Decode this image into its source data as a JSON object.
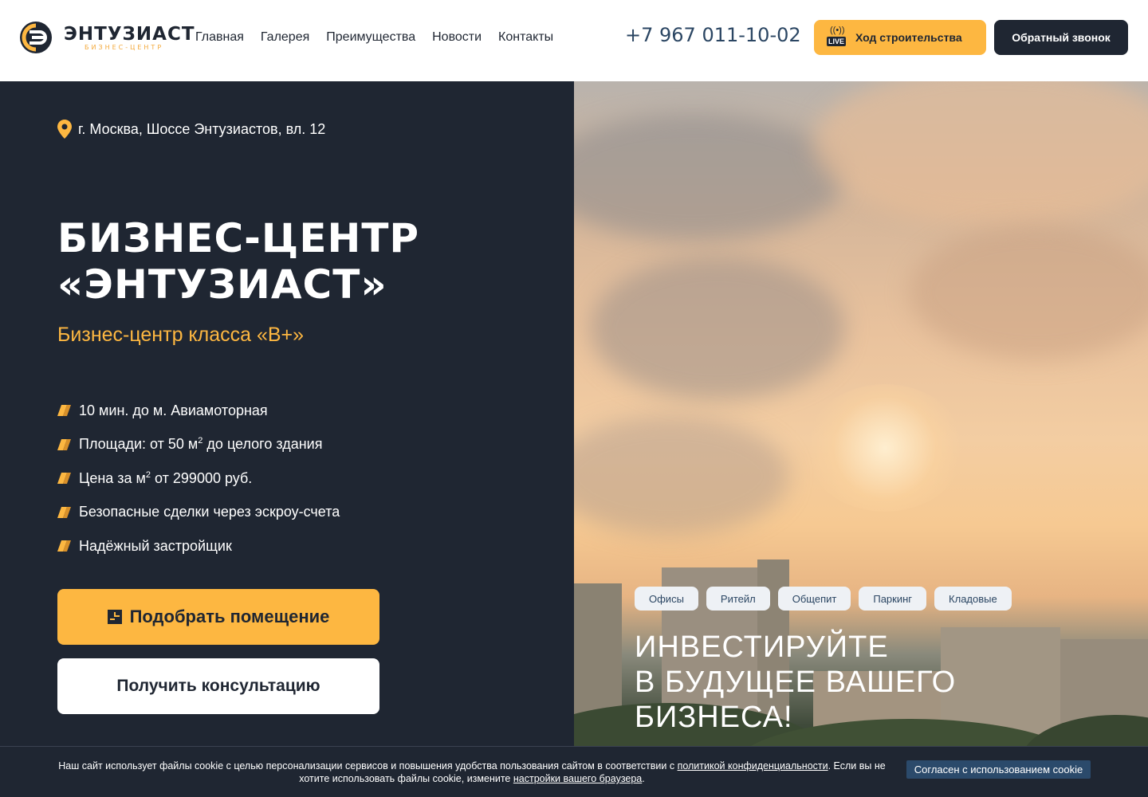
{
  "brand": {
    "name": "ЭНТУЗИАСТ",
    "subtitle": "БИЗНЕС-ЦЕНТР",
    "accent_color": "#fdb741",
    "dark_color": "#1f2632"
  },
  "nav": {
    "items": [
      {
        "label": "Главная"
      },
      {
        "label": "Галерея"
      },
      {
        "label": "Преимущества"
      },
      {
        "label": "Новости"
      },
      {
        "label": "Контакты"
      }
    ]
  },
  "header": {
    "phone": "+7 967 011-10-02",
    "live_badge": "LIVE",
    "live_button": "Ход строительства",
    "callback_button": "Обратный звонок"
  },
  "hero": {
    "address": "г. Москва, Шоссе Энтузиастов, вл. 12",
    "title_line1": "БИЗНЕС-ЦЕНТР",
    "title_line2": "«ЭНТУЗИАСТ»",
    "subtitle": "Бизнес-центр класса «B+»",
    "features": {
      "f1": "10 мин. до м. Авиамоторная",
      "f2_prefix": "Площади: от 50 м",
      "f2_sup": "2",
      "f2_suffix": " до целого здания",
      "f3_prefix": "Цена за м",
      "f3_sup": "2",
      "f3_suffix": " от 299000 руб.",
      "f4": "Безопасные сделки через эскроу-счета",
      "f5": "Надёжный застройщик"
    },
    "pick_button": "Подобрать помещение",
    "consult_button": "Получить консультацию"
  },
  "promo": {
    "chips": [
      "Офисы",
      "Ритейл",
      "Общепит",
      "Паркинг",
      "Кладовые"
    ],
    "headline_line1": "ИНВЕСТИРУЙТЕ",
    "headline_line2": "В БУДУЩЕЕ ВАШЕГО",
    "headline_line3": "БИЗНЕСА!"
  },
  "cookie": {
    "text_part1": "Наш сайт использует файлы cookie с целью персонализации сервисов и повышения удобства пользования сайтом в соответствии с ",
    "link_privacy": "политикой конфиденциальности",
    "text_part2": ". Если вы не хотите использовать файлы cookie, измените ",
    "link_browser": "настройки вашего браузера",
    "text_part3": ".",
    "accept_button": "Согласен с использованием cookie"
  }
}
